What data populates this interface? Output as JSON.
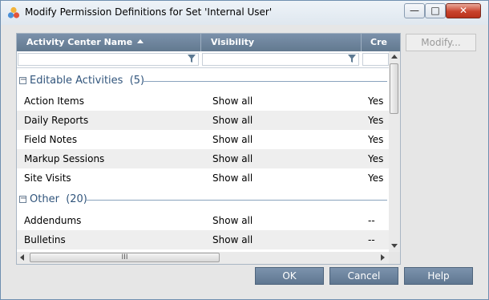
{
  "window": {
    "title": "Modify Permission Definitions for Set 'Internal User'",
    "controls": {
      "minimize": "—",
      "maximize": "□",
      "close": "✕"
    }
  },
  "grid": {
    "columns": [
      {
        "label": "Activity Center Name",
        "sort": "ascending"
      },
      {
        "label": "Visibility"
      },
      {
        "label": "Cre"
      }
    ],
    "groups": [
      {
        "name": "Editable Activities",
        "count": "(5)",
        "rows": [
          {
            "name": "Action Items",
            "visibility": "Show all",
            "create": "Yes"
          },
          {
            "name": "Daily Reports",
            "visibility": "Show all",
            "create": "Yes"
          },
          {
            "name": "Field Notes",
            "visibility": "Show all",
            "create": "Yes"
          },
          {
            "name": "Markup Sessions",
            "visibility": "Show all",
            "create": "Yes"
          },
          {
            "name": "Site Visits",
            "visibility": "Show all",
            "create": "Yes"
          }
        ]
      },
      {
        "name": "Other",
        "count": "(20)",
        "rows": [
          {
            "name": "Addendums",
            "visibility": "Show all",
            "create": "--"
          },
          {
            "name": "Bulletins",
            "visibility": "Show all",
            "create": "--"
          }
        ]
      }
    ],
    "hscroll_grip": "III"
  },
  "buttons": {
    "modify": "Modify...",
    "ok": "OK",
    "cancel": "Cancel",
    "help": "Help"
  },
  "colors": {
    "header_bg": "#6b8299",
    "group_text": "#31557c",
    "action_button": "#6e859f"
  }
}
